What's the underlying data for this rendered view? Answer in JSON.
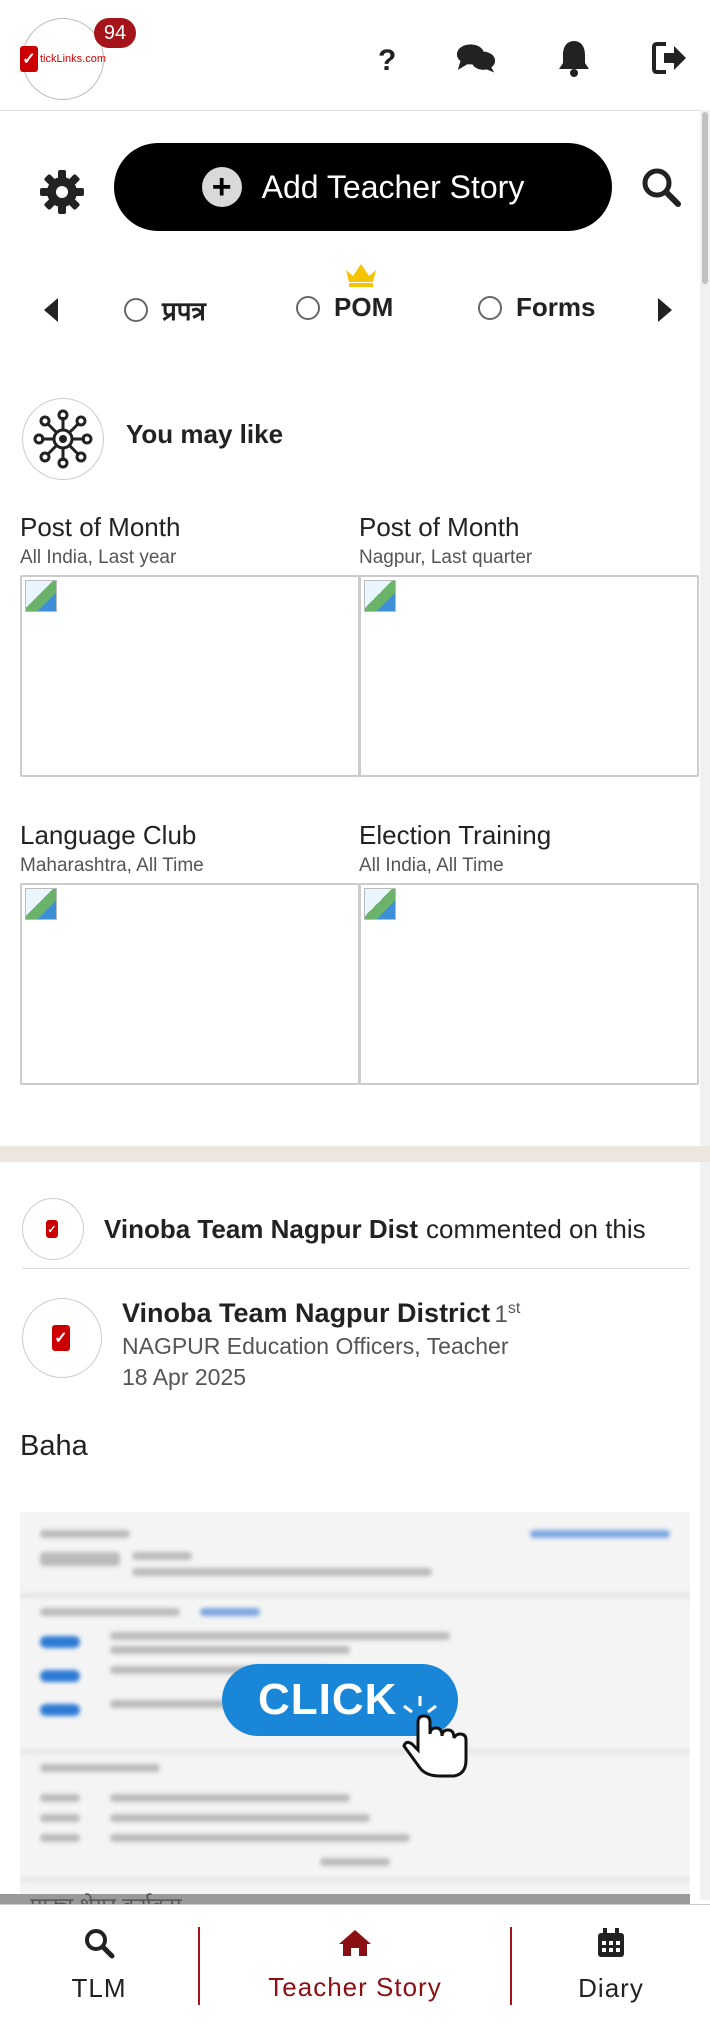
{
  "header": {
    "logo_text": "tickLinks.com",
    "notification_count": "94",
    "icons": [
      "help-icon",
      "chat-icon",
      "bell-icon",
      "logout-icon"
    ]
  },
  "actions": {
    "add_story_label": "Add Teacher Story"
  },
  "filters": {
    "options": [
      "प्रपत्र",
      "POM",
      "Forms"
    ]
  },
  "may_like": {
    "title": "You may like",
    "cards": [
      {
        "title": "Post of Month",
        "subtitle": "All India, Last year"
      },
      {
        "title": "Post of Month",
        "subtitle": "Nagpur, Last quarter"
      },
      {
        "title": "Language Club",
        "subtitle": "Maharashtra, All Time"
      },
      {
        "title": "Election Training",
        "subtitle": "All India, All Time"
      }
    ]
  },
  "feed": {
    "commenter": "Vinoba Team Nagpur Dist",
    "comment_suffix": "commented on this",
    "post": {
      "author": "Vinoba Team Nagpur District",
      "degree": "1",
      "degree_suffix": "st",
      "role": "NAGPUR Education Officers, Teacher",
      "date": "18 Apr 2025",
      "text": "Baha",
      "image_overlay_label": "CLICK",
      "partial_caption": "पाठ्य शेयर कर्यकम"
    }
  },
  "bottom_nav": {
    "tabs": [
      {
        "label": "TLM",
        "icon": "search-icon"
      },
      {
        "label": "Teacher Story",
        "icon": "home-icon"
      },
      {
        "label": "Diary",
        "icon": "calendar-icon"
      }
    ],
    "active_color": "#8a1014"
  },
  "colors": {
    "badge": "#a5141a",
    "accent": "#a5141a",
    "click_button": "#1a86d8",
    "crown": "#f5c400"
  }
}
